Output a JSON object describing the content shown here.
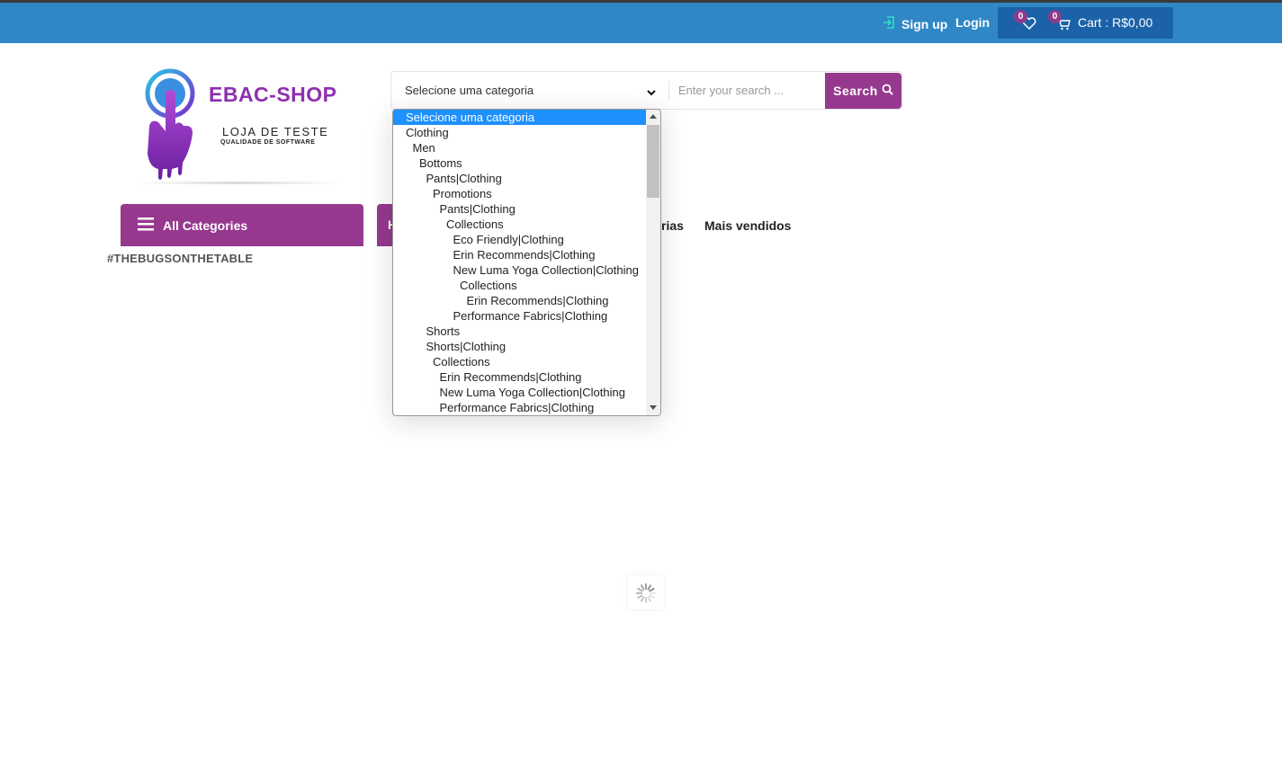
{
  "header": {
    "signup_label": "Sign up",
    "login_label": "Login",
    "wishlist_count": "0",
    "cart_count": "0",
    "cart_label": "Cart : R$0,00",
    "bar_color": "#2f87c6",
    "cart_bg_color": "#1b62a8",
    "badge_color": "#8e3b8c"
  },
  "logo": {
    "title": "EBAC-SHOP",
    "subtitle": "LOJA DE TESTE",
    "tagline": "QUALIDADE DE SOFTWARE"
  },
  "search": {
    "category_selected": "Selecione uma categoria",
    "placeholder": "Enter your search ...",
    "button_label": "Search",
    "accent_color": "#96398e"
  },
  "nav": {
    "all_categories_label": "All Categories",
    "home_label": "H",
    "partial_label": "rias",
    "best_sellers_label": "Mais vendidos"
  },
  "hashtag": "#THEBUGSONTHETABLE",
  "dropdown": {
    "options": [
      {
        "label": "Selecione uma categoria",
        "level": 0,
        "selected": true
      },
      {
        "label": "Clothing",
        "level": 0
      },
      {
        "label": "Men",
        "level": 1
      },
      {
        "label": "Bottoms",
        "level": 2
      },
      {
        "label": "Pants|Clothing",
        "level": 3
      },
      {
        "label": "Promotions",
        "level": 4
      },
      {
        "label": "Pants|Clothing",
        "level": 5
      },
      {
        "label": "Collections",
        "level": 6
      },
      {
        "label": "Eco Friendly|Clothing",
        "level": 7
      },
      {
        "label": "Erin Recommends|Clothing",
        "level": 7
      },
      {
        "label": "New Luma Yoga Collection|Clothing",
        "level": 7
      },
      {
        "label": "Collections",
        "level": 8
      },
      {
        "label": "Erin Recommends|Clothing",
        "level": 9
      },
      {
        "label": "Performance Fabrics|Clothing",
        "level": 7
      },
      {
        "label": "Shorts",
        "level": 3
      },
      {
        "label": "Shorts|Clothing",
        "level": 3
      },
      {
        "label": "Collections",
        "level": 4
      },
      {
        "label": "Erin Recommends|Clothing",
        "level": 5
      },
      {
        "label": "New Luma Yoga Collection|Clothing",
        "level": 5
      },
      {
        "label": "Performance Fabrics|Clothing",
        "level": 5
      }
    ]
  }
}
